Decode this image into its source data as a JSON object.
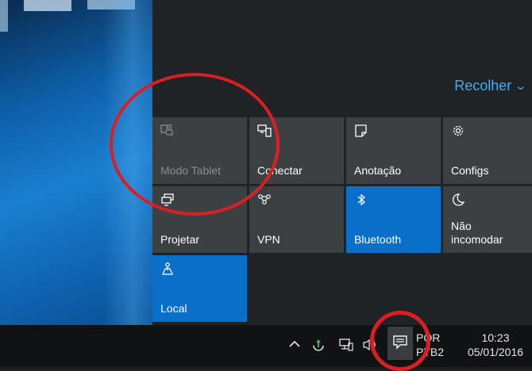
{
  "action_center": {
    "collapse_label": "Recolher",
    "collapse_icon": "chevron-down-icon",
    "tiles": [
      {
        "label": "Modo Tablet",
        "icon": "tablet-mode-icon",
        "state": "disabled"
      },
      {
        "label": "Conectar",
        "icon": "connect-icon",
        "state": "off"
      },
      {
        "label": "Anotação",
        "icon": "note-icon",
        "state": "off"
      },
      {
        "label": "Configs",
        "icon": "gear-icon",
        "state": "off"
      },
      {
        "label": "Projetar",
        "icon": "project-icon",
        "state": "off"
      },
      {
        "label": "VPN",
        "icon": "vpn-icon",
        "state": "off"
      },
      {
        "label": "Bluetooth",
        "icon": "bluetooth-icon",
        "state": "on"
      },
      {
        "label": "Não\nincomodar",
        "icon": "moon-icon",
        "state": "off"
      },
      {
        "label": "Local",
        "icon": "location-icon",
        "state": "on"
      }
    ]
  },
  "taskbar": {
    "tray_icons": [
      "chevron-up-icon",
      "update-icon",
      "network-icon",
      "volume-icon"
    ],
    "notification_icon": "notification-icon",
    "language_line1": "POR",
    "language_line2": "PTB2",
    "time": "10:23",
    "date": "05/01/2016"
  },
  "colors": {
    "accent": "#0a6fc8",
    "tile": "#3c4043",
    "panel": "#1f2326",
    "annotation": "#d91f24",
    "link": "#4ca8e8"
  }
}
